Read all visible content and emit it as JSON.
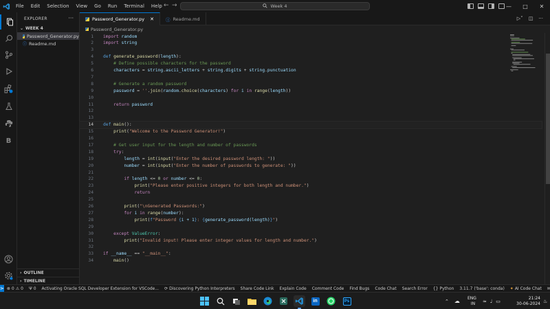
{
  "titlebar": {
    "menu": [
      "File",
      "Edit",
      "Selection",
      "View",
      "Go",
      "Run",
      "Terminal",
      "Help"
    ],
    "search_text": "Week 4"
  },
  "sidebar": {
    "title": "EXPLORER",
    "folder": "WEEK 4",
    "files": [
      {
        "name": "Password_Generator.py",
        "icon": "python-file-icon",
        "selected": true
      },
      {
        "name": "Readme.md",
        "icon": "info-icon",
        "selected": false
      }
    ],
    "outline": "OUTLINE",
    "timeline": "TIMELINE"
  },
  "tabs": [
    {
      "label": "Password_Generator.py",
      "active": true
    },
    {
      "label": "Readme.md",
      "active": false
    }
  ],
  "breadcrumb": "Password_Generator.py",
  "editor": {
    "current_line": 14,
    "lines": [
      "import random",
      "import string",
      "",
      "def generate_password(length):",
      "    # Define possible characters for the password",
      "    characters = string.ascii_letters + string.digits + string.punctuation",
      "",
      "    # Generate a random password",
      "    password = ''.join(random.choice(characters) for i in range(length))",
      "",
      "    return password",
      "",
      "",
      "def main():",
      "    print(\"Welcome to the Password Generator!\")",
      "",
      "    # Get user input for the length and number of passwords",
      "    try:",
      "        length = int(input(\"Enter the desired password length: \"))",
      "        number = int(input(\"Enter the number of passwords to generate: \"))",
      "",
      "        if length <= 0 or number <= 0:",
      "            print(\"Please enter positive integers for both length and number.\")",
      "            return",
      "",
      "        print(\"\\nGenerated Passwords:\")",
      "        for i in range(number):",
      "            print(f\"Password {i + 1}: {generate_password(length)}\")",
      "",
      "    except ValueError:",
      "        print(\"Invalid input! Please enter integer values for length and number.\")",
      "",
      "if __name__ == \"__main__\":",
      "    main()"
    ]
  },
  "statusbar": {
    "errors": "0",
    "warnings": "0",
    "ports": "0",
    "left_items": [
      "Activating Oracle SQL Developer Extension for VSCode...",
      "Discovering Python Interpreters",
      "Share Code Link",
      "Explain Code",
      "Comment Code",
      "Find Bugs",
      "Code Chat",
      "Search Error"
    ],
    "language": "Python",
    "interpreter": "3.11.7 ('base': conda)",
    "ai_chat": "AI Code Chat"
  },
  "taskbar": {
    "lang_top": "ENG",
    "lang_bottom": "IN",
    "time": "21:24",
    "date": "30-06-2024"
  }
}
